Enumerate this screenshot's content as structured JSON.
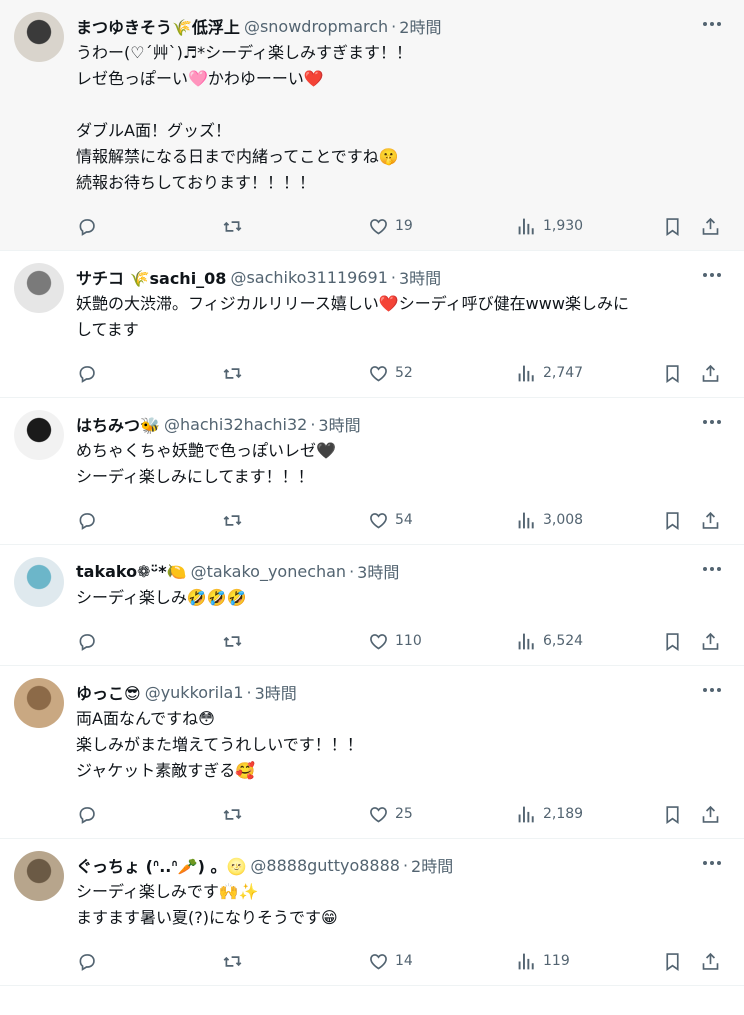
{
  "posts": [
    {
      "name": "まつゆきそう🌾低浮上",
      "handle": "@snowdropmarch",
      "time": "2時間",
      "lines": [
        "うわー(♡´艸`)♬*シーディ楽しみすぎます！！",
        "レゼ色っぽーい🩷かわゆーーい❤️",
        "",
        "ダブルA面！グッズ！",
        "情報解禁になる日まで内緒ってことですね🤫",
        "続報お待ちしております！！！！"
      ],
      "replies": "",
      "retweets": "",
      "likes": "19",
      "views": "1,930",
      "avatar_colors": [
        "#d9d4cc",
        "#3a3a3a"
      ],
      "highlighted": true
    },
    {
      "name": "サチコ 🌾sachi_08",
      "handle": "@sachiko31119691",
      "time": "3時間",
      "lines": [
        "妖艶の大渋滞。フィジカルリリース嬉しい❤️シーディ呼び健在www楽しみに",
        "してます"
      ],
      "likes": "52",
      "views": "2,747",
      "avatar_colors": [
        "#e6e6e6",
        "#7a7a7a"
      ],
      "highlighted": false
    },
    {
      "name": "はちみつ🐝",
      "handle": "@hachi32hachi32",
      "time": "3時間",
      "lines": [
        "めちゃくちゃ妖艶で色っぽいレゼ🖤",
        "シーディ楽しみにしてます！！！"
      ],
      "likes": "54",
      "views": "3,008",
      "avatar_colors": [
        "#f2f2f2",
        "#1a1a1a"
      ],
      "highlighted": false
    },
    {
      "name": "takako❁ᵕ̈*🍋",
      "handle": "@takako_yonechan",
      "time": "3時間",
      "lines": [
        "シーディ楽しみ🤣🤣🤣"
      ],
      "likes": "110",
      "views": "6,524",
      "avatar_colors": [
        "#dfe9ee",
        "#6cb6c9"
      ],
      "highlighted": false
    },
    {
      "name": "ゆっこ😎",
      "handle": "@yukkorila1",
      "time": "3時間",
      "lines": [
        "両A面なんですね😳",
        "楽しみがまた増えてうれしいです！！！",
        "ジャケット素敵すぎる🥰"
      ],
      "likes": "25",
      "views": "2,189",
      "avatar_colors": [
        "#c9a882",
        "#8c6a48"
      ],
      "highlighted": false
    },
    {
      "name": "ぐっちょ (ᐢ..ᐢ🥕) 。🌝",
      "handle": "@8888guttyo8888",
      "time": "2時間",
      "lines": [
        "シーディ楽しみです🙌✨",
        "ますます暑い夏(?)になりそうです😁"
      ],
      "likes": "14",
      "views": "119",
      "avatar_colors": [
        "#b7a58c",
        "#6b5a45"
      ],
      "highlighted": false
    }
  ]
}
